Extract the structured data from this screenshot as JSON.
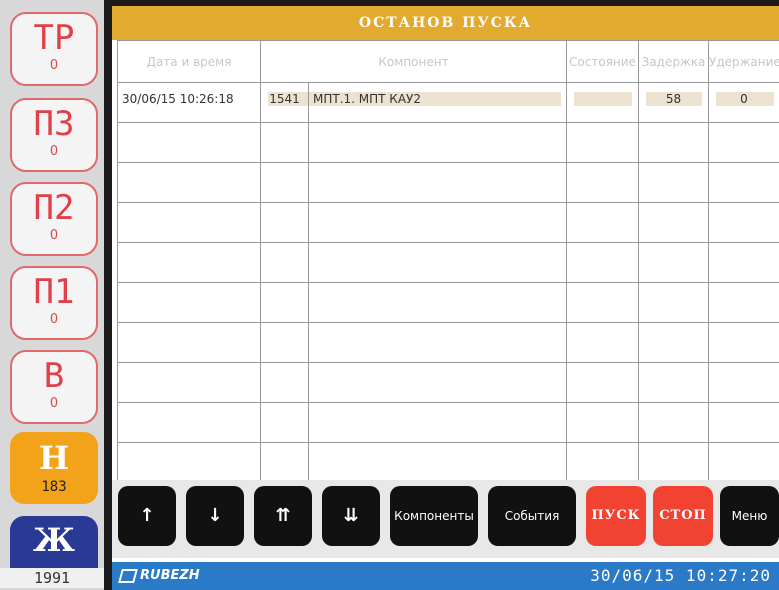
{
  "left_panel": {
    "tr": {
      "code": "ТР",
      "count": "0"
    },
    "p3": {
      "code": "П3",
      "count": "0"
    },
    "p2": {
      "code": "П2",
      "count": "0"
    },
    "p1": {
      "code": "П1",
      "count": "0"
    },
    "b": {
      "code": "В",
      "count": "0"
    },
    "h": {
      "code": "Н",
      "count": "183"
    },
    "zh": {
      "code": "Ж",
      "count": "1991"
    }
  },
  "screen": {
    "title": "ОСТАНОВ ПУСКА"
  },
  "table": {
    "headers": {
      "date": "Дата и время",
      "component": "Компонент",
      "state": "Состояние",
      "delay": "Задержка",
      "hold": "Удержание"
    },
    "rows": [
      {
        "date": "30/06/15 10:26:18",
        "num": "1541",
        "name": "МПТ.1. МПТ КАУ2",
        "state": "",
        "delay": "58",
        "hold": "0"
      }
    ]
  },
  "toolbar": {
    "up": "↑",
    "down": "↓",
    "pgup": "⇈",
    "pgdn": "⇊",
    "components": "Компоненты",
    "events": "События",
    "start": "ПУСК",
    "stop": "СТОП",
    "menu": "Меню"
  },
  "status": {
    "logo": "RUBEZH",
    "datetime": "30/06/15  10:27:20"
  },
  "colors": {
    "title_bar": "#e2aa2e",
    "status_bar": "#2a7ac8",
    "alarm_button": "#f24232",
    "counter_red": "#e0404a",
    "h_button": "#f2a31a",
    "zh_button": "#2a3a94"
  }
}
